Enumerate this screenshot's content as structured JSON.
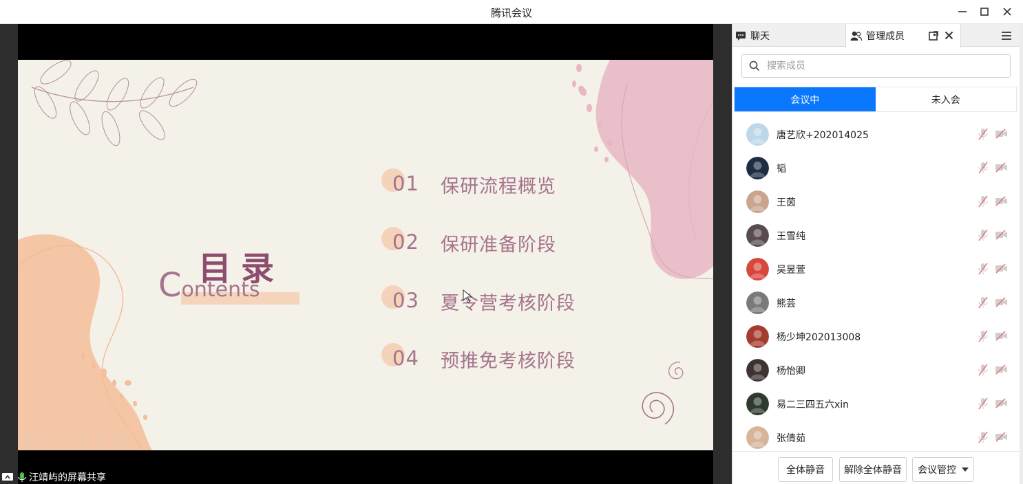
{
  "window": {
    "title": "腾讯会议"
  },
  "slide": {
    "heading": "目录",
    "subheading_cap": "C",
    "subheading_rest": "ontents",
    "items": [
      {
        "num": "01",
        "text": "保研流程概览"
      },
      {
        "num": "02",
        "text": "保研准备阶段"
      },
      {
        "num": "03",
        "text": "夏令营考核阶段"
      },
      {
        "num": "04",
        "text": "预推免考核阶段"
      }
    ],
    "colors": {
      "accent": "#a5748d",
      "peach": "#f5c6a5",
      "pink": "#e9bfca",
      "background": "#f4f1e8"
    }
  },
  "share_status": {
    "label": "汪靖屿的屏幕共享"
  },
  "panel": {
    "tabs": {
      "chat": "聊天",
      "members": "管理成员"
    },
    "search": {
      "placeholder": "搜索成员"
    },
    "segments": {
      "in_meeting": "会议中",
      "not_joined": "未入会"
    },
    "members": [
      {
        "name": "唐艺欣+202014025",
        "avatar_color": "#bcd7ea"
      },
      {
        "name": "韬",
        "avatar_color": "#1d2d44"
      },
      {
        "name": "王茵",
        "avatar_color": "#c9a58f"
      },
      {
        "name": "王雪纯",
        "avatar_color": "#5a4b51"
      },
      {
        "name": "吴昱萱",
        "avatar_color": "#d8473c"
      },
      {
        "name": "熊芸",
        "avatar_color": "#7a7a7a"
      },
      {
        "name": "杨少坤202013008",
        "avatar_color": "#a53c2f"
      },
      {
        "name": "杨怡卿",
        "avatar_color": "#3e3330"
      },
      {
        "name": "易二三四五六xin",
        "avatar_color": "#2f3a2f"
      },
      {
        "name": "张倩茹",
        "avatar_color": "#d6b59a"
      }
    ],
    "footer": {
      "mute_all": "全体静音",
      "unmute_all": "解除全体静音",
      "meeting_control": "会议管控"
    },
    "colors": {
      "primary": "#0a77ff",
      "muted_icon": "#e87a7a"
    }
  }
}
